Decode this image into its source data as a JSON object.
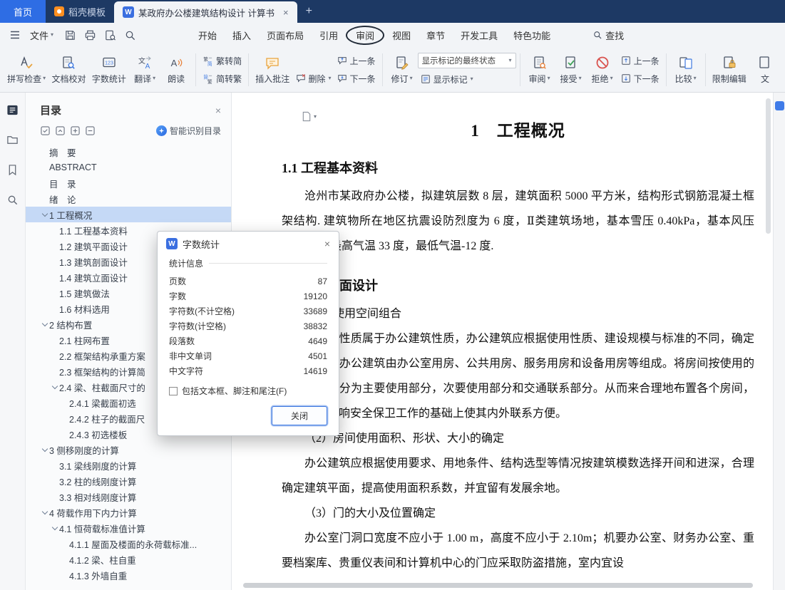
{
  "tabbar": {
    "home": "首页",
    "docer": "稻壳模板",
    "document_title": "某政府办公楼建筑结构设计 计算书",
    "new_tab": "+"
  },
  "menubar": {
    "file": "文件",
    "tabs": [
      "开始",
      "插入",
      "页面布局",
      "引用",
      "审阅",
      "视图",
      "章节",
      "开发工具",
      "特色功能"
    ],
    "active_tab": "审阅",
    "find": "查找",
    "quickbar_icons": [
      "save",
      "print",
      "print-preview",
      "find-replace"
    ]
  },
  "ribbon": {
    "spell_check": "拼写检查",
    "doc_proofing": "文档校对",
    "word_count": "字数统计",
    "translate": "翻译",
    "read_aloud": "朗读",
    "trad_to_simp": "繁转简",
    "simp_to_trad": "简转繁",
    "insert_comment": "插入批注",
    "delete": "删除",
    "prev_comment": "上一条",
    "next_comment": "下一条",
    "revise": "修订",
    "markup_state": "显示标记的最终状态",
    "show_markup": "显示标记",
    "review_menu": "审阅",
    "accept": "接受",
    "reject": "拒绝",
    "prev_change": "上一条",
    "next_change": "下一条",
    "compare": "比较",
    "restrict_editing": "限制编辑",
    "truncated_label": "文"
  },
  "left_panel_icons": [
    "toc",
    "pages",
    "bookmark",
    "search"
  ],
  "sidebar": {
    "title": "目录",
    "smart_toc": "智能识别目录",
    "items": [
      {
        "label": "摘　要",
        "level": 0,
        "arrow": false,
        "selected": false
      },
      {
        "label": "ABSTRACT",
        "level": 0,
        "arrow": false,
        "selected": false
      },
      {
        "label": "目　录",
        "level": 0,
        "arrow": false,
        "selected": false
      },
      {
        "label": "绪　论",
        "level": 0,
        "arrow": false,
        "selected": false
      },
      {
        "label": "1  工程概况",
        "level": 0,
        "arrow": true,
        "selected": true
      },
      {
        "label": "1.1 工程基本资料",
        "level": 1,
        "arrow": false,
        "selected": false
      },
      {
        "label": "1.2 建筑平面设计",
        "level": 1,
        "arrow": false,
        "selected": false
      },
      {
        "label": "1.3 建筑剖面设计",
        "level": 1,
        "arrow": false,
        "selected": false
      },
      {
        "label": "1.4 建筑立面设计",
        "level": 1,
        "arrow": false,
        "selected": false
      },
      {
        "label": "1.5 建筑做法",
        "level": 1,
        "arrow": false,
        "selected": false
      },
      {
        "label": "1.6  材料选用",
        "level": 1,
        "arrow": false,
        "selected": false
      },
      {
        "label": "2  结构布置",
        "level": 0,
        "arrow": true,
        "selected": false
      },
      {
        "label": "2.1  柱网布置",
        "level": 1,
        "arrow": false,
        "selected": false
      },
      {
        "label": "2.2  框架结构承重方案",
        "level": 1,
        "arrow": false,
        "selected": false
      },
      {
        "label": "2.3  框架结构的计算简",
        "level": 1,
        "arrow": false,
        "selected": false
      },
      {
        "label": "2.4  梁、柱截面尺寸的",
        "level": 1,
        "arrow": true,
        "selected": false
      },
      {
        "label": "2.4.1  梁截面初选",
        "level": 2,
        "arrow": false,
        "selected": false
      },
      {
        "label": "2.4.2  柱子的截面尺",
        "level": 2,
        "arrow": false,
        "selected": false
      },
      {
        "label": "2.4.3  初选楼板",
        "level": 2,
        "arrow": false,
        "selected": false
      },
      {
        "label": "3  侧移刚度的计算",
        "level": 0,
        "arrow": true,
        "selected": false
      },
      {
        "label": "3.1 梁线刚度的计算",
        "level": 1,
        "arrow": false,
        "selected": false
      },
      {
        "label": "3.2 柱的线刚度计算",
        "level": 1,
        "arrow": false,
        "selected": false
      },
      {
        "label": "3.3 相对线刚度计算",
        "level": 1,
        "arrow": false,
        "selected": false
      },
      {
        "label": "4  荷载作用下内力计算",
        "level": 0,
        "arrow": true,
        "selected": false
      },
      {
        "label": "4.1  恒荷载标准值计算",
        "level": 1,
        "arrow": true,
        "selected": false
      },
      {
        "label": "4.1.1  屋面及楼面的永荷载标准...",
        "level": 2,
        "arrow": false,
        "selected": false
      },
      {
        "label": "4.1.2 梁、柱自重",
        "level": 2,
        "arrow": false,
        "selected": false
      },
      {
        "label": "4.1.3 外墙自重",
        "level": 2,
        "arrow": false,
        "selected": false
      }
    ]
  },
  "dialog": {
    "title": "字数统计",
    "section": "统计信息",
    "stats": [
      {
        "label": "页数",
        "value": "87"
      },
      {
        "label": "字数",
        "value": "19120"
      },
      {
        "label": "字符数(不计空格)",
        "value": "33689"
      },
      {
        "label": "字符数(计空格)",
        "value": "38832"
      },
      {
        "label": "段落数",
        "value": "4649"
      },
      {
        "label": "非中文单词",
        "value": "4501"
      },
      {
        "label": "中文字符",
        "value": "14619"
      }
    ],
    "checkbox_label": "包括文本框、脚注和尾注(F)",
    "checkbox_checked": false,
    "close": "关闭"
  },
  "document": {
    "heading1": "1　工程概况",
    "heading11": "1.1  工程基本资料",
    "para1": "沧州市某政府办公楼，拟建筑层数 8 层，建筑面积 5000 平方米，结构形式钢筋混凝土框架结构. 建筑物所在地区抗震设防烈度为 6 度，Ⅱ类建筑场地，基本雪压 0.40kPa，基本风压 0.45kPa，最高气温 33 度，最低气温-12 度.",
    "heading12": "1.2 建筑平面设计",
    "item1": "（1）使用空间组合",
    "para2": "本设计性质属于办公建筑性质，办公建筑应根据使用性质、建设规模与标准的不同，确定各类用房。办公建筑由办公室用房、公共用房、服务用房和设备用房等组成。将房间按使用的性质分类，分为主要使用部分，次要使用部分和交通联系部分。从而来合理地布置各个房间，同时在不影响安全保卫工作的基础上使其内外联系方便。",
    "item2": "（2）房间使用面积、形状、大小的确定",
    "para3": "办公建筑应根据使用要求、用地条件、结构选型等情况按建筑模数选择开间和进深，合理确定建筑平面，提高使用面积系数，并宜留有发展余地。",
    "item3": "（3）门的大小及位置确定",
    "para4": "办公室门洞口宽度不应小于 1.00 m，高度不应小于 2.10m；机要办公室、财务办公室、重要档案库、贵重仪表间和计算机中心的门应采取防盗措施，室内宜设"
  }
}
